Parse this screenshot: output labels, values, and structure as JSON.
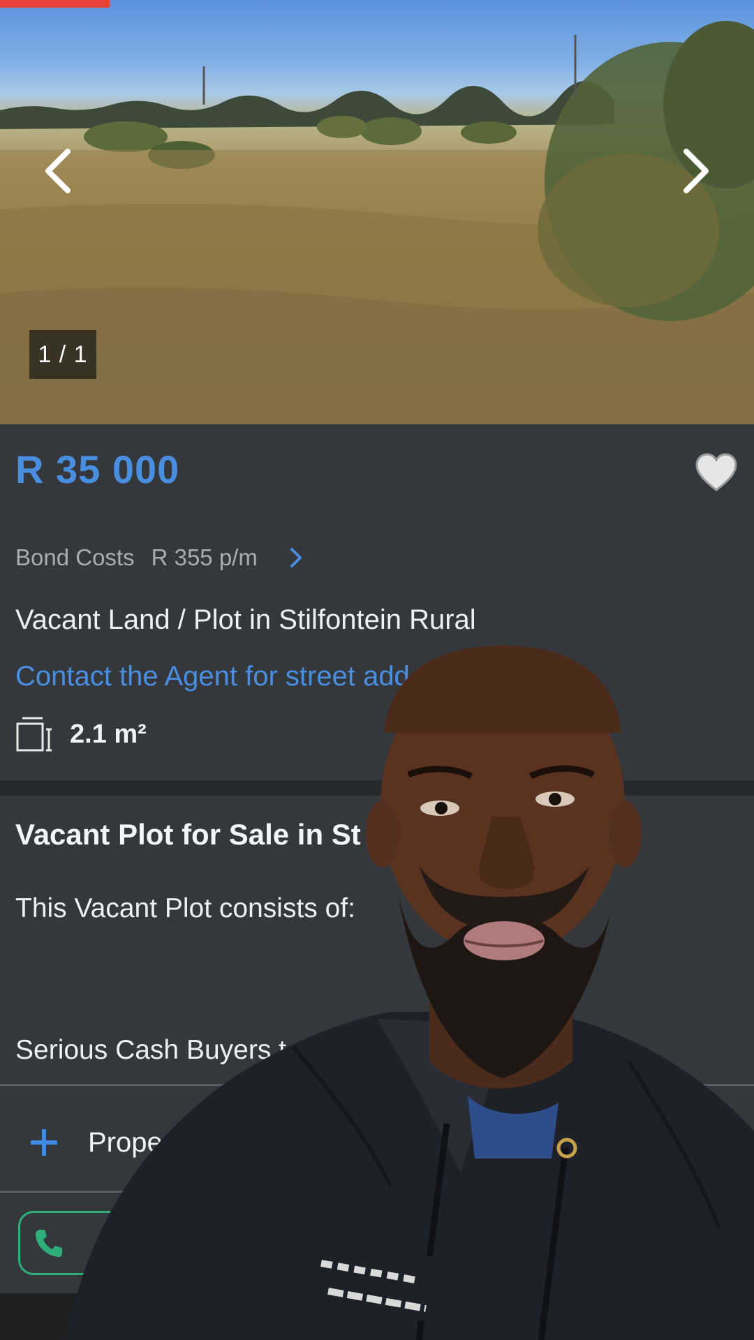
{
  "gallery": {
    "counter": "1 / 1",
    "prev_icon": "chevron-left-icon",
    "next_icon": "chevron-right-icon"
  },
  "listing": {
    "price": "R 35 000",
    "favorite_icon": "heart-icon",
    "bond_label": "Bond Costs",
    "bond_value": "R 355 p/m",
    "title": "Vacant Land / Plot in Stilfontein Rural",
    "address_link": "Contact the Agent for street add",
    "size_icon": "floor-area-icon",
    "size": "2.1 m²"
  },
  "description": {
    "heading": "Vacant Plot for Sale in St",
    "line1": "This Vacant Plot consists of:",
    "line2": "Serious Cash Buyers t"
  },
  "details": {
    "label": "Property D",
    "icon": "plus-icon"
  },
  "contact": {
    "call_icon": "phone-icon"
  },
  "colors": {
    "accent_blue": "#4a8ee0",
    "panel_bg": "#34383c",
    "red_tab": "#e8413a",
    "call_green": "#2eaf7a"
  }
}
